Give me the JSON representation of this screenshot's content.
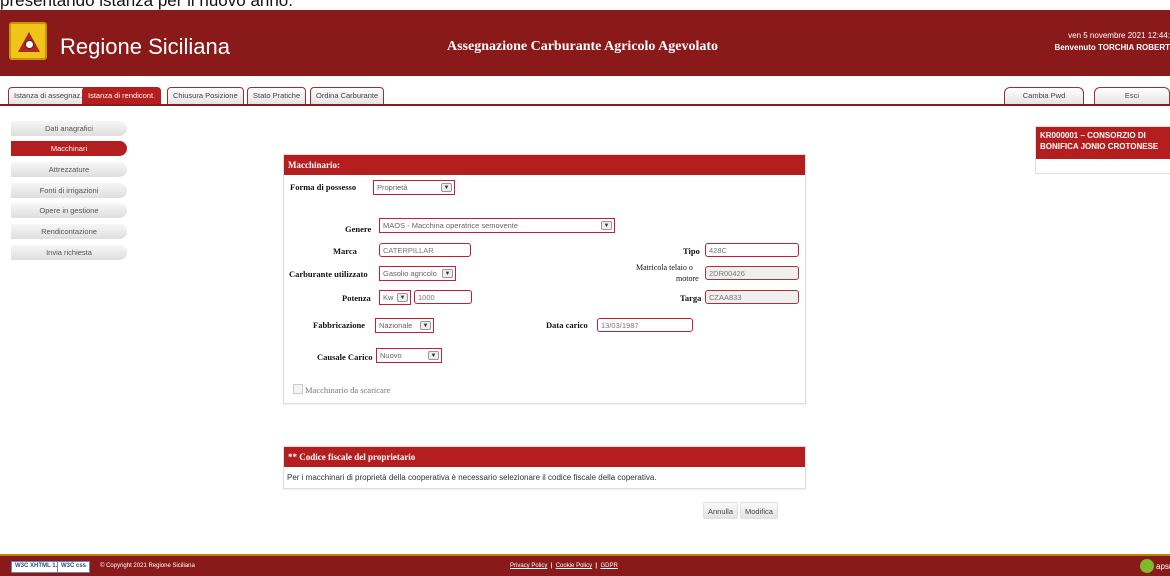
{
  "crop_text": "presentando istanza per il nuovo anno.",
  "header": {
    "brand": "Regione Siciliana",
    "app_title": "Assegnazione Carburante Agricolo Agevolato",
    "date": "ven 5 novembre 2021 12:44:",
    "user": "Benvenuto TORCHIA ROBERT",
    "bg_color": "#8a1a1a",
    "accent_color": "#b41e1e"
  },
  "tabs": [
    {
      "label": "Istanza di assegnaz."
    },
    {
      "label": "Istanza di rendicont."
    },
    {
      "label": "Chiusura Posizione"
    },
    {
      "label": "Stato Pratiche"
    },
    {
      "label": "Ordina Carburante"
    }
  ],
  "right_tabs": [
    {
      "label": "Cambia Pwd"
    },
    {
      "label": "Esci"
    }
  ],
  "sidebar": {
    "items": [
      {
        "label": "Dati anagrafici"
      },
      {
        "label": "Macchinari"
      },
      {
        "label": "Attrezzature"
      },
      {
        "label": "Fonti di irrigazioni"
      },
      {
        "label": "Opere in gestione"
      },
      {
        "label": "Rendicontazione"
      },
      {
        "label": "Invia richiesta"
      }
    ],
    "active": "Macchinari"
  },
  "infocard": {
    "title": "KR000001 – CONSORZIO DI BONIFICA JONIO CROTONESE"
  },
  "form": {
    "title": "Macchinario:",
    "forma_label": "Forma di possesso",
    "forma_value": "Proprietà",
    "genere_label": "Genere",
    "genere_value": "MAOS - Macchina operatrice semovente",
    "marca_label": "Marca",
    "marca_value": "CATERPILLAR",
    "tipo_label": "Tipo",
    "tipo_value": "428C",
    "carburante_label": "Carburante utilizzato",
    "carburante_value": "Gasolio agricolo",
    "matricola_label_1": "Matricola telaio o",
    "matricola_label_2": "motore",
    "matricola_value": "2DR00426",
    "potenza_label": "Potenza",
    "potenza_unit": "Kw",
    "potenza_value": "1000",
    "targa_label": "Targa",
    "targa_value": "CZAA833",
    "fabbricazione_label": "Fabbricazione",
    "fabbricazione_value": "Nazionale",
    "data_carico_label": "Data carico",
    "data_carico_value": "13/03/1987",
    "causale_label": "Causale Carico",
    "causale_value": "Nuovo",
    "scaricare_label": "Macchinario da scaricare"
  },
  "codice": {
    "title": "** Codice fiscale del proprietario",
    "note": "Per i macchinari di proprietà della cooperativa è necessario selezionare il codice fiscale della coperativa."
  },
  "buttons": {
    "annulla": "Annulla",
    "modifica": "Modifica"
  },
  "footer": {
    "w3c_xhtml": "W3C XHTML 1.0",
    "w3c_css": "W3C css",
    "copyright": "© Copyright 2021 Regione Siciliana",
    "privacy": "Privacy Policy",
    "cookie": "Cookie Policy",
    "gdpr": "GDPR",
    "sep": "|",
    "apsne": "apsne"
  }
}
